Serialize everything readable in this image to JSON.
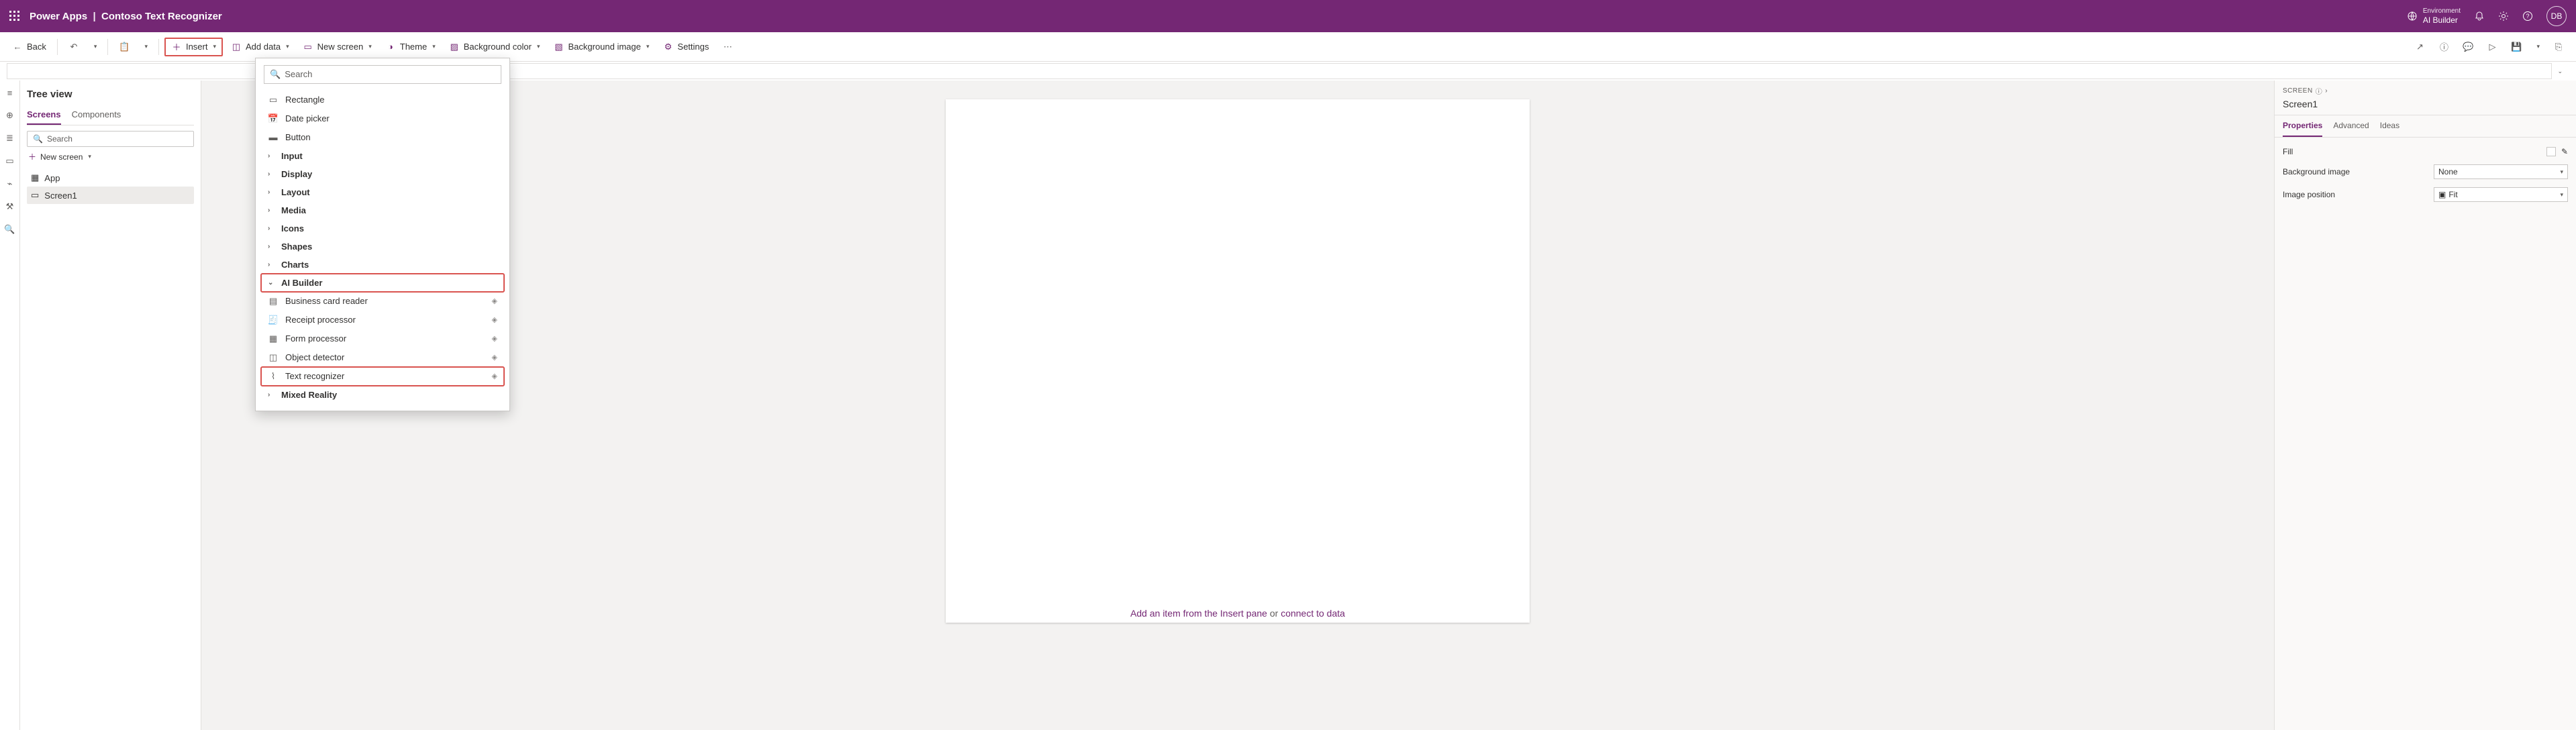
{
  "topbar": {
    "product": "Power Apps",
    "app_name": "Contoso Text Recognizer",
    "env_label": "Environment",
    "env_name": "AI Builder",
    "user_initials": "DB"
  },
  "cmdbar": {
    "back": "Back",
    "insert": "Insert",
    "add_data": "Add data",
    "new_screen": "New screen",
    "theme": "Theme",
    "bg_color": "Background color",
    "bg_image": "Background image",
    "settings": "Settings"
  },
  "tree": {
    "title": "Tree view",
    "tab_screens": "Screens",
    "tab_components": "Components",
    "search_ph": "Search",
    "new_screen": "New screen",
    "app": "App",
    "screen1": "Screen1"
  },
  "insert_dd": {
    "search_ph": "Search",
    "rectangle": "Rectangle",
    "date_picker": "Date picker",
    "button": "Button",
    "input": "Input",
    "display": "Display",
    "layout": "Layout",
    "media": "Media",
    "icons": "Icons",
    "shapes": "Shapes",
    "charts": "Charts",
    "ai_builder": "AI Builder",
    "biz_card": "Business card reader",
    "receipt": "Receipt processor",
    "form_proc": "Form processor",
    "obj_det": "Object detector",
    "text_rec": "Text recognizer",
    "mixed_reality": "Mixed Reality"
  },
  "canvas": {
    "hint_a": "Add an item from the Insert pane",
    "hint_or": " or ",
    "hint_b": "connect to data"
  },
  "prop": {
    "label": "SCREEN",
    "name": "Screen1",
    "tab_props": "Properties",
    "tab_adv": "Advanced",
    "tab_ideas": "Ideas",
    "fill": "Fill",
    "bg_image": "Background image",
    "bg_image_val": "None",
    "img_pos": "Image position",
    "img_pos_val": "Fit"
  }
}
